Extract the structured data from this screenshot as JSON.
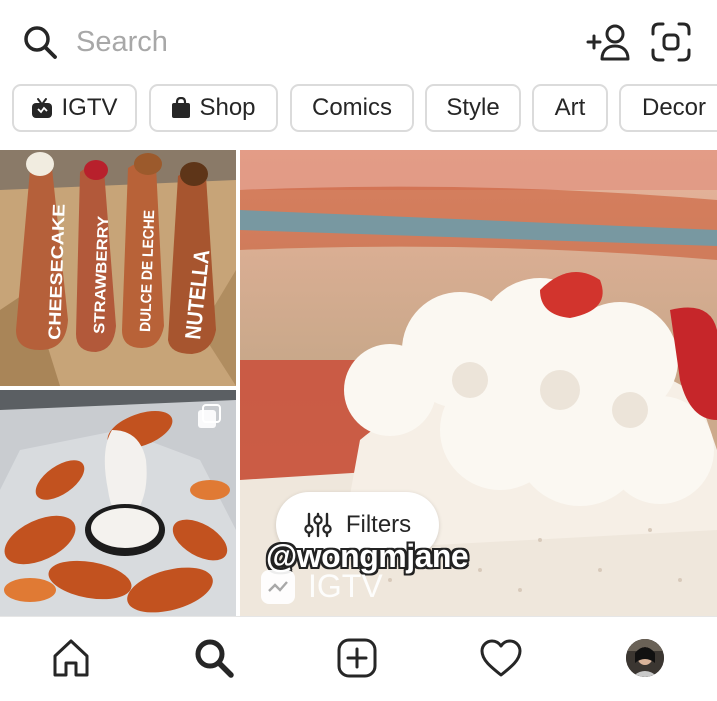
{
  "search": {
    "placeholder": "Search",
    "icons": [
      "search-icon",
      "add-person-icon",
      "scan-icon"
    ]
  },
  "categories": [
    {
      "label": "IGTV",
      "icon": "igtv-icon"
    },
    {
      "label": "Shop",
      "icon": "shopping-bag-icon"
    },
    {
      "label": "Comics"
    },
    {
      "label": "Style"
    },
    {
      "label": "Art"
    },
    {
      "label": "Decor"
    }
  ],
  "grid": {
    "churros_labels": [
      "CHEESECAKE",
      "STRAWBERRY",
      "DULCE DE LECHE",
      "NUTELLA"
    ],
    "filters_label": "Filters",
    "video_username": "@wongmjane",
    "video_source": "IGTV"
  },
  "nav": {
    "icons": [
      "home-icon",
      "search-icon",
      "new-post-icon",
      "activity-heart-icon",
      "profile-avatar"
    ]
  },
  "colors": {
    "text": "#262626",
    "placeholder": "#a8a8a8",
    "border": "#dbdbdb",
    "background": "#ffffff"
  }
}
